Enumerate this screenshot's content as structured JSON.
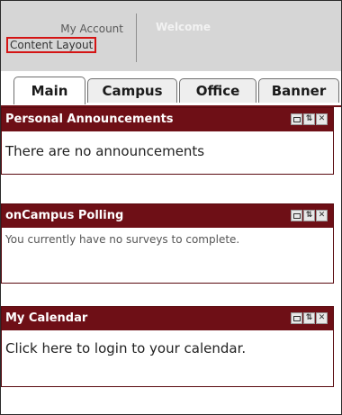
{
  "header": {
    "my_account": "My Account",
    "content_layout": "Content Layout",
    "welcome": "Welcome"
  },
  "tabs": [
    {
      "label": "Main",
      "active": true
    },
    {
      "label": "Campus",
      "active": false
    },
    {
      "label": "Office",
      "active": false
    },
    {
      "label": "Banner",
      "active": false
    }
  ],
  "portlets": [
    {
      "title": "Personal Announcements",
      "body": "There are no announcements"
    },
    {
      "title": "onCampus Polling",
      "body": "You currently have no surveys to complete."
    },
    {
      "title": "My Calendar",
      "body": "Click here to login to your calendar."
    }
  ],
  "colors": {
    "accent": "#6e0f16",
    "highlight_box": "#d41414"
  },
  "icons": [
    "minimize-icon",
    "move-icon",
    "close-icon"
  ]
}
